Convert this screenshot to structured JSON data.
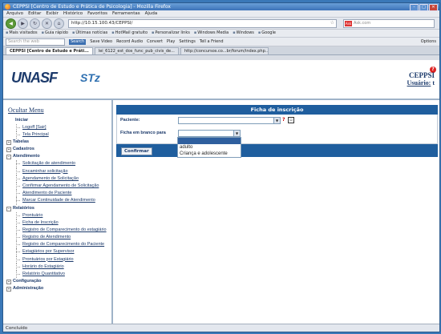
{
  "window": {
    "title": "CEPPSI [Centro de Estudo e Prática de Psicologia] - Mozilla Firefox"
  },
  "menubar": [
    "Arquivo",
    "Editar",
    "Exibir",
    "Histórico",
    "Favoritos",
    "Ferramentas",
    "Ajuda"
  ],
  "navbar": {
    "url": "http://10.15.100.43/CEPPSI/",
    "search_placeholder": "Ask.com"
  },
  "bookmarks": [
    "Mais visitados",
    "Guia rápido",
    "Últimas notícias",
    "HotMail gratuito",
    "Personalizar links",
    "Windows Media",
    "Windows",
    "Google"
  ],
  "toolbar2": {
    "search_placeholder": "Search the web",
    "search_button": "Search",
    "items": [
      "Save Video",
      "Record Audio",
      "Convert",
      "Play",
      "Settings",
      "Tell a Friend"
    ],
    "options": "Options"
  },
  "tabs": [
    "CEPPSI [Centro de Estudo e Práti...",
    "lei_6122_est_dos_func_pub_civis_de...",
    "http://concursos.co...br/forum/index.php..."
  ],
  "header": {
    "logo_left": "UNASF",
    "logo_right": "STz",
    "brand": "CEPPSI",
    "user_label": "Usuário:",
    "user_value": "t"
  },
  "sidebar": {
    "toggle": "Ocultar Menu",
    "groups": [
      {
        "label": "Iniciar",
        "items": [
          "Logoff [Sair]",
          "Tela Principal"
        ]
      },
      {
        "label": "Tabelas",
        "items": []
      },
      {
        "label": "Cadastros",
        "items": []
      },
      {
        "label": "Atendimento",
        "items": [
          "Solicitação de atendimento",
          "Encaminhar solicitação",
          "Agendamento de Solicitação",
          "Confirmar Agendamento de Solicitação",
          "Atendimento de Paciente",
          "Marcar Continuidade de Atendimento"
        ]
      },
      {
        "label": "Relatórios",
        "items": [
          "Prontuário",
          "Ficha de Inscrição",
          "Registro de Comparecimento do estagiário",
          "Registro de Atendimento",
          "Registro de Comparecimento do Paciente",
          "Estagiários por Supervisor",
          "Prontuários por Estagiário",
          "Horário do Estagiário",
          "Relatório Quantitativo"
        ]
      },
      {
        "label": "Configuração",
        "items": []
      },
      {
        "label": "Administração",
        "items": []
      }
    ]
  },
  "form": {
    "title": "Ficha de inscrição",
    "paciente_label": "Paciente:",
    "ficha_label": "Ficha em branco para",
    "qmark": "?",
    "confirm_button": "Confirmar",
    "dropdown_options": [
      "",
      "adulto",
      "Criança e adolescente"
    ]
  },
  "status": {
    "text": "Concluído"
  },
  "colors": {
    "panel_header": "#1f5e9e",
    "link": "#1c3a6b",
    "window_bg": "#3a78b8"
  }
}
